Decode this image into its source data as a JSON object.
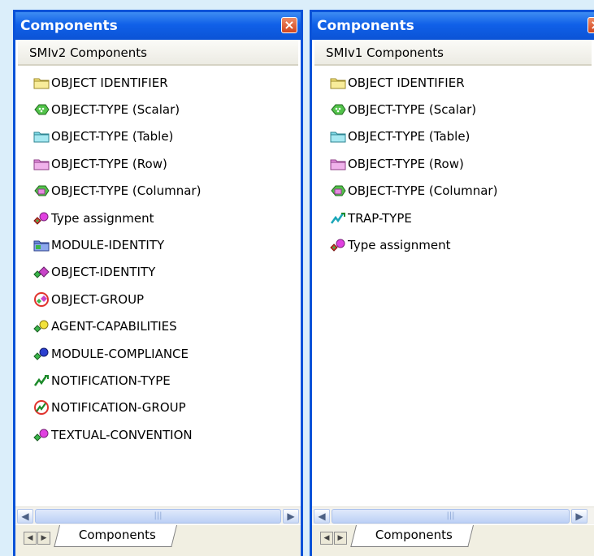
{
  "panels": [
    {
      "title": "Components",
      "header": "SMIv2 Components",
      "items": [
        {
          "label": "OBJECT IDENTIFIER",
          "icon": "folder-yellow-icon"
        },
        {
          "label": "OBJECT-TYPE (Scalar)",
          "icon": "scalar-green-icon"
        },
        {
          "label": "OBJECT-TYPE (Table)",
          "icon": "folder-cyan-icon"
        },
        {
          "label": "OBJECT-TYPE (Row)",
          "icon": "folder-pink-icon"
        },
        {
          "label": "OBJECT-TYPE (Columnar)",
          "icon": "columnar-green-pink-icon"
        },
        {
          "label": "Type assignment",
          "icon": "type-assignment-icon"
        },
        {
          "label": "MODULE-IDENTITY",
          "icon": "module-identity-icon"
        },
        {
          "label": "OBJECT-IDENTITY",
          "icon": "object-identity-icon"
        },
        {
          "label": "OBJECT-GROUP",
          "icon": "object-group-icon"
        },
        {
          "label": "AGENT-CAPABILITIES",
          "icon": "agent-capabilities-icon"
        },
        {
          "label": "MODULE-COMPLIANCE",
          "icon": "module-compliance-icon"
        },
        {
          "label": "NOTIFICATION-TYPE",
          "icon": "notification-type-icon"
        },
        {
          "label": "NOTIFICATION-GROUP",
          "icon": "notification-group-icon"
        },
        {
          "label": "TEXTUAL-CONVENTION",
          "icon": "textual-convention-icon"
        }
      ],
      "tab": "Components"
    },
    {
      "title": "Components",
      "header": "SMIv1 Components",
      "items": [
        {
          "label": "OBJECT IDENTIFIER",
          "icon": "folder-yellow-icon"
        },
        {
          "label": "OBJECT-TYPE (Scalar)",
          "icon": "scalar-green-icon"
        },
        {
          "label": "OBJECT-TYPE (Table)",
          "icon": "folder-cyan-icon"
        },
        {
          "label": "OBJECT-TYPE (Row)",
          "icon": "folder-pink-icon"
        },
        {
          "label": "OBJECT-TYPE (Columnar)",
          "icon": "columnar-green-pink-icon"
        },
        {
          "label": "TRAP-TYPE",
          "icon": "trap-type-icon"
        },
        {
          "label": "Type assignment",
          "icon": "type-assignment-icon"
        }
      ],
      "tab": "Components"
    }
  ],
  "colors": {
    "titlebar": "#0b53d6",
    "frame": "#0a52d8",
    "close_button": "#d0441d",
    "background": "#dbeefa"
  },
  "icons": {
    "close": "close-icon",
    "scroll_left": "arrow-left-icon",
    "scroll_right": "arrow-right-icon",
    "tab_prev": "tab-prev-icon",
    "tab_next": "tab-next-icon"
  }
}
